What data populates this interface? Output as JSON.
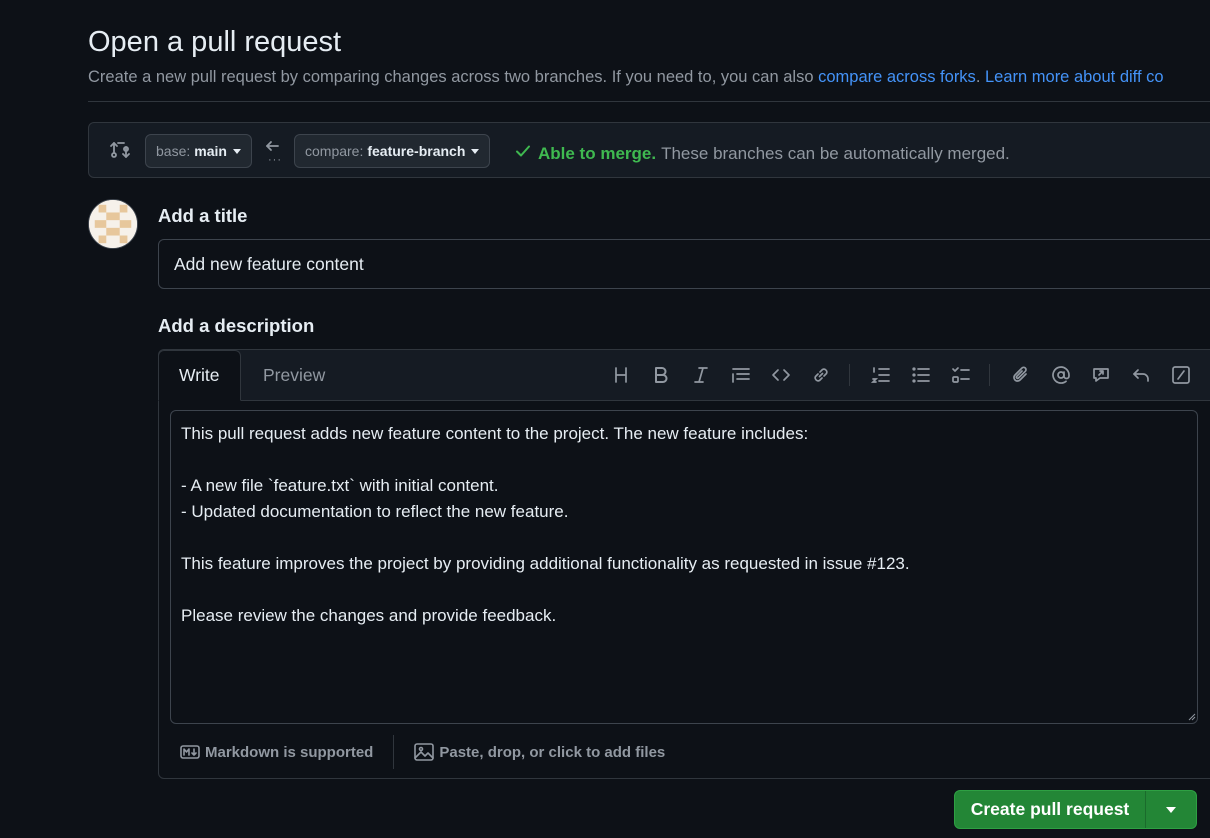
{
  "page": {
    "title": "Open a pull request",
    "subtitle_text": "Create a new pull request by comparing changes across two branches. If you need to, you can also ",
    "subtitle_link1": "compare across forks",
    "subtitle_sep": ". ",
    "subtitle_link2": "Learn more about diff co"
  },
  "range": {
    "base_label": "base:",
    "base_branch": "main",
    "compare_label": "compare:",
    "compare_branch": "feature-branch",
    "merge_ok": "Able to merge.",
    "merge_note": "These branches can be automatically merged."
  },
  "form": {
    "title_label": "Add a title",
    "title_value": "Add new feature content",
    "description_label": "Add a description",
    "tabs": [
      "Write",
      "Preview"
    ],
    "toolbar_icons": [
      "heading-icon",
      "bold-icon",
      "italic-icon",
      "quote-icon",
      "code-icon",
      "link-icon",
      "numbered-list-icon",
      "unordered-list-icon",
      "task-list-icon",
      "attach-icon",
      "mention-icon",
      "reference-icon",
      "undo-icon",
      "slash-commands-icon"
    ],
    "body_value": "This pull request adds new feature content to the project. The new feature includes:\n\n- A new file `feature.txt` with initial content.\n- Updated documentation to reflect the new feature.\n\nThis feature improves the project by providing additional functionality as requested in issue #123.\n\nPlease review the changes and provide feedback.",
    "markdown_note": "Markdown is supported",
    "attach_note": "Paste, drop, or click to add files"
  },
  "actions": {
    "create_label": "Create pull request"
  },
  "colors": {
    "background": "#0d1117",
    "link": "#4493f8",
    "success": "#3fb950",
    "primary_button": "#238636"
  }
}
